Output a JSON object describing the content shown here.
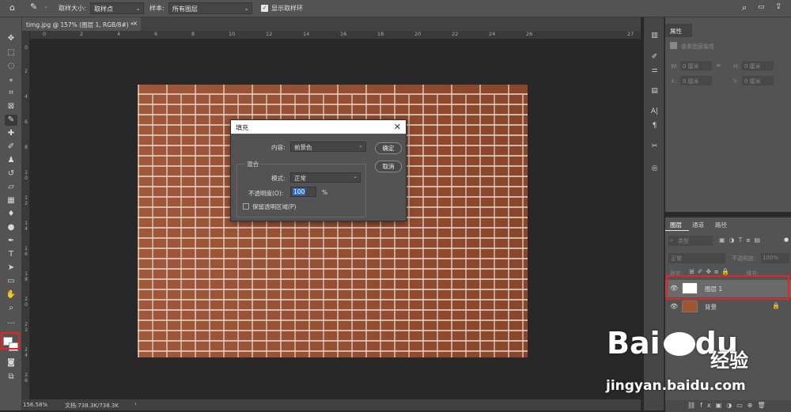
{
  "optionsbar": {
    "sample_size_label": "取样大小:",
    "sample_size_value": "取样点",
    "sample_label": "样本:",
    "sample_value": "所有图层",
    "show_ring_label": "显示取样环"
  },
  "document_tab": {
    "title": "timg.jpg @ 157% (图层 1, RGB/8#) *",
    "close": "×"
  },
  "ruler_h": [
    "0",
    "2",
    "4",
    "6",
    "8",
    "10",
    "12",
    "14",
    "16",
    "18",
    "20",
    "22",
    "24",
    "26",
    "27"
  ],
  "ruler_v": [
    "0",
    "2",
    "4",
    "6",
    "8",
    "1 0",
    "1 2",
    "1 4",
    "1 6",
    "1 8",
    "2 0",
    "2 2",
    "2 4",
    "2 6"
  ],
  "status": {
    "zoom": "156.58%",
    "doc": "文档:738.3K/738.3K",
    "arrow": "›"
  },
  "fill_dialog": {
    "title": "填充",
    "content_label": "内容:",
    "content_value": "前景色",
    "ok_label": "确定",
    "cancel_label": "取消",
    "blend_group_label": "混合",
    "mode_label": "模式:",
    "mode_value": "正常",
    "opacity_label": "不透明度(O):",
    "opacity_value": "100",
    "opacity_unit": "%",
    "preserve_label": "保留透明区域(P)"
  },
  "properties": {
    "tab_label": "属性",
    "kind": "像素图层属性",
    "w_label": "W:",
    "w_value": "0 厘米",
    "h_label": "H:",
    "h_value": "0 厘米",
    "x_label": "X:",
    "x_value": "0 厘米",
    "y_label": "Y:",
    "y_value": "0 厘米"
  },
  "layers": {
    "tabs": [
      "图层",
      "通道",
      "路径"
    ],
    "filter_label": "类型",
    "blend_mode": "正常",
    "opacity_label": "不透明度:",
    "opacity_value": "100%",
    "lock_label": "锁定:",
    "fill_label": "填充:",
    "items": [
      {
        "name": "图层 1",
        "selected": true
      },
      {
        "name": "背景",
        "selected": false
      }
    ]
  },
  "watermark": {
    "brand": "Bai",
    "brand2": "du",
    "cn": "经验",
    "url": "jingyan.baidu.com"
  },
  "colors": {
    "highlight": "#e52525",
    "panel": "#535353",
    "canvas_bg": "#282828"
  }
}
